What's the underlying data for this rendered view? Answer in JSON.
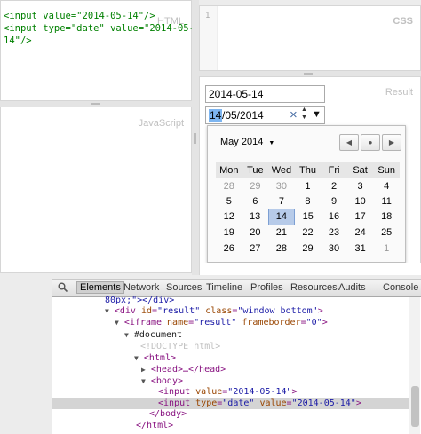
{
  "html_panel": {
    "label": "HTML",
    "line1": "<input value=\"2014-05-14\"/>",
    "line2a": "<input type=\"date\" value=\"2014-05-",
    "line2b": "14\"/>"
  },
  "css_panel": {
    "label": "CSS",
    "line_number": "1"
  },
  "js_panel": {
    "label": "JavaScript"
  },
  "result_panel": {
    "label": "Result",
    "text_input_value": "2014-05-14",
    "date_day": "14",
    "date_rest": "/05/2014",
    "clear_symbol": "×",
    "up_symbol": "▲",
    "down_symbol": "▼",
    "dropdown_symbol": "▼"
  },
  "calendar": {
    "month_label": "May 2014",
    "month_arrow": "▼",
    "prev_symbol": "◀",
    "today_symbol": "●",
    "next_symbol": "▶",
    "weekdays": [
      "Mon",
      "Tue",
      "Wed",
      "Thu",
      "Fri",
      "Sat",
      "Sun"
    ],
    "weeks": [
      [
        {
          "d": "28",
          "dim": true
        },
        {
          "d": "29",
          "dim": true
        },
        {
          "d": "30",
          "dim": true
        },
        {
          "d": "1"
        },
        {
          "d": "2"
        },
        {
          "d": "3"
        },
        {
          "d": "4"
        }
      ],
      [
        {
          "d": "5"
        },
        {
          "d": "6"
        },
        {
          "d": "7"
        },
        {
          "d": "8"
        },
        {
          "d": "9"
        },
        {
          "d": "10"
        },
        {
          "d": "11"
        }
      ],
      [
        {
          "d": "12"
        },
        {
          "d": "13"
        },
        {
          "d": "14",
          "sel": true
        },
        {
          "d": "15"
        },
        {
          "d": "16"
        },
        {
          "d": "17"
        },
        {
          "d": "18"
        }
      ],
      [
        {
          "d": "19"
        },
        {
          "d": "20"
        },
        {
          "d": "21"
        },
        {
          "d": "22"
        },
        {
          "d": "23"
        },
        {
          "d": "24"
        },
        {
          "d": "25"
        }
      ],
      [
        {
          "d": "26"
        },
        {
          "d": "27"
        },
        {
          "d": "28"
        },
        {
          "d": "29"
        },
        {
          "d": "30"
        },
        {
          "d": "31"
        },
        {
          "d": "1",
          "dim": true
        }
      ]
    ]
  },
  "devtools": {
    "tabs": [
      "Elements",
      "Network",
      "Sources",
      "Timeline",
      "Profiles",
      "Resources",
      "Audits",
      "Console"
    ],
    "active_tab": "Elements",
    "dom": {
      "l0": "80px;\"></div>",
      "l1_tag": "<div ",
      "l1_a1": "id",
      "l1_v1": "\"result\"",
      "l1_a2": "class",
      "l1_v2": "\"window bottom\"",
      "l2_tag": "<iframe ",
      "l2_a1": "name",
      "l2_v1": "\"result\"",
      "l2_a2": "frameborder",
      "l2_v2": "\"0\"",
      "l3": "#document",
      "l4": "<!DOCTYPE html>",
      "l5": "<html>",
      "l6": "<head>…</head>",
      "l7": "<body>",
      "l8_tag": "<input ",
      "l8_a1": "value",
      "l8_v1": "\"2014-05-14\"",
      "l9_tag": "<input ",
      "l9_a1": "type",
      "l9_v1": "\"date\"",
      "l9_a2": "value",
      "l9_v2": "\"2014-05-14\"",
      "l10": "</body>",
      "l11": "</html>"
    }
  },
  "colors": {
    "selected_day": "#b7cbe9",
    "highlight_row": "#d4d4d4"
  }
}
